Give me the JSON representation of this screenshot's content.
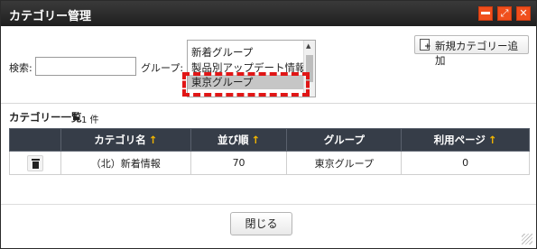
{
  "window": {
    "title": "カテゴリー管理",
    "controls": [
      "minimize-icon",
      "maximize-icon",
      "close-icon"
    ],
    "accent_color": "#f04f1c"
  },
  "search": {
    "label": "検索:",
    "value": "",
    "placeholder": ""
  },
  "group_filter": {
    "label": "グループ:",
    "options": [
      "新着グループ",
      "製品別アップデート情報",
      "東京グループ"
    ],
    "selected": "東京グループ"
  },
  "add_button": {
    "label": "新規カテゴリー追加",
    "icon": "add-document-icon"
  },
  "category_list": {
    "heading": "カテゴリー一覧",
    "count": "1 件",
    "columns": [
      {
        "label": "",
        "sort": ""
      },
      {
        "label": "カテゴリ名",
        "sort": "↑"
      },
      {
        "label": "並び順",
        "sort": "↑"
      },
      {
        "label": "グループ",
        "sort": ""
      },
      {
        "label": "利用ページ",
        "sort": "↑"
      }
    ],
    "rows": [
      {
        "icon": "trash-icon",
        "name": "（北）新着情報",
        "order": "70",
        "group": "東京グループ",
        "pages": "0"
      }
    ]
  },
  "footer": {
    "close_label": "閉じる"
  },
  "colors": {
    "header_bg": "#363d48",
    "sort_arrow": "#f2b500",
    "highlight": "#e01616"
  }
}
